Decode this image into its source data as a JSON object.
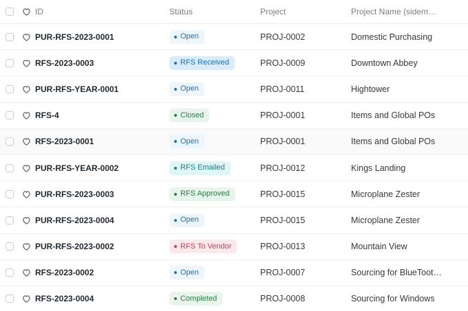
{
  "columns": {
    "id": "ID",
    "status": "Status",
    "project": "Project",
    "project_name": "Project Name (sidem…"
  },
  "status_colors": {
    "Open": "blue",
    "RFS Received": "blue-strong",
    "Closed": "green",
    "RFS Emailed": "cyan",
    "RFS Approved": "green",
    "RFS To Vendor": "red",
    "Completed": "green"
  },
  "rows": [
    {
      "id": "PUR-RFS-2023-0001",
      "status": "Open",
      "project": "PROJ-0002",
      "project_name": "Domestic Purchasing"
    },
    {
      "id": "RFS-2023-0003",
      "status": "RFS Received",
      "project": "PROJ-0009",
      "project_name": "Downtown Abbey"
    },
    {
      "id": "PUR-RFS-YEAR-0001",
      "status": "Open",
      "project": "PROJ-0011",
      "project_name": "Hightower"
    },
    {
      "id": "RFS-4",
      "status": "Closed",
      "project": "PROJ-0001",
      "project_name": "Items and Global POs"
    },
    {
      "id": "RFS-2023-0001",
      "status": "Open",
      "project": "PROJ-0001",
      "project_name": "Items and Global POs"
    },
    {
      "id": "PUR-RFS-YEAR-0002",
      "status": "RFS Emailed",
      "project": "PROJ-0012",
      "project_name": "Kings Landing"
    },
    {
      "id": "PUR-RFS-2023-0003",
      "status": "RFS Approved",
      "project": "PROJ-0015",
      "project_name": "Microplane Zester"
    },
    {
      "id": "PUR-RFS-2023-0004",
      "status": "Open",
      "project": "PROJ-0015",
      "project_name": "Microplane Zester"
    },
    {
      "id": "PUR-RFS-2023-0002",
      "status": "RFS To Vendor",
      "project": "PROJ-0013",
      "project_name": "Mountain View"
    },
    {
      "id": "RFS-2023-0002",
      "status": "Open",
      "project": "PROJ-0007",
      "project_name": "Sourcing for BlueToot…"
    },
    {
      "id": "RFS-2023-0004",
      "status": "Completed",
      "project": "PROJ-0008",
      "project_name": "Sourcing for Windows"
    }
  ]
}
